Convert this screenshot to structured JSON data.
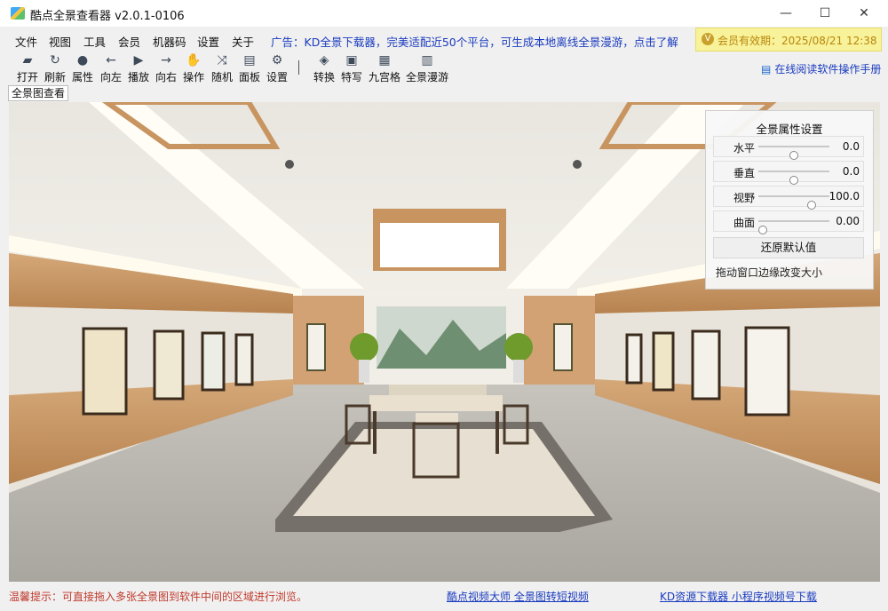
{
  "window": {
    "title": "酷点全景查看器 v2.0.1-0106",
    "minimize": "—",
    "maximize": "☐",
    "close": "✕"
  },
  "menu": {
    "items": [
      "文件",
      "视图",
      "工具",
      "会员",
      "机器码",
      "设置",
      "关于"
    ],
    "ad": "广告：KD全景下载器，完美适配近50个平台，可生成本地离线全景漫游，点击了解",
    "vip": "会员有效期：2025/08/21 12:38"
  },
  "toolbar": {
    "items": [
      {
        "label": "打开",
        "icon": "folder-open-icon",
        "glyph": "▰"
      },
      {
        "label": "刷新",
        "icon": "refresh-icon",
        "glyph": "↻"
      },
      {
        "label": "属性",
        "icon": "info-icon",
        "glyph": "●"
      },
      {
        "label": "向左",
        "icon": "arrow-left-icon",
        "glyph": "←"
      },
      {
        "label": "播放",
        "icon": "play-icon",
        "glyph": "▶"
      },
      {
        "label": "向右",
        "icon": "arrow-right-icon",
        "glyph": "→"
      },
      {
        "label": "操作",
        "icon": "hand-icon",
        "glyph": "✋"
      },
      {
        "label": "随机",
        "icon": "shuffle-icon",
        "glyph": "⤨"
      },
      {
        "label": "面板",
        "icon": "panel-icon",
        "glyph": "▤"
      },
      {
        "label": "设置",
        "icon": "gear-icon",
        "glyph": "⚙"
      },
      {
        "label": "转换",
        "icon": "cube-icon",
        "glyph": "◈"
      },
      {
        "label": "特写",
        "icon": "image-icon",
        "glyph": "▣"
      },
      {
        "label": "九宫格",
        "icon": "grid-icon",
        "glyph": "▦"
      },
      {
        "label": "全景漫游",
        "icon": "panorama-icon",
        "glyph": "▥"
      }
    ],
    "manual": "在线阅读软件操作手册"
  },
  "tab": {
    "label": "全景图查看"
  },
  "panel": {
    "title": "全景属性设置",
    "rows": [
      {
        "label": "水平",
        "value": "0.0",
        "position": 0.5
      },
      {
        "label": "垂直",
        "value": "0.0",
        "position": 0.5
      },
      {
        "label": "视野",
        "value": "100.0",
        "position": 0.78
      },
      {
        "label": "曲面",
        "value": "0.00",
        "position": 0.0
      }
    ],
    "reset": "还原默认值",
    "hint": "拖动窗口边缘改变大小"
  },
  "status": {
    "tip": "温馨提示：可直接拖入多张全景图到软件中间的区域进行浏览。",
    "link1": "酷点视频大师 全景图转短视频",
    "link2": "KD资源下载器 小程序视频号下载"
  },
  "colors": {
    "accent_link": "#1a3bbf",
    "tip": "#c0392b",
    "vip_bg": "#f8f29a",
    "vip_text": "#b8860b"
  }
}
